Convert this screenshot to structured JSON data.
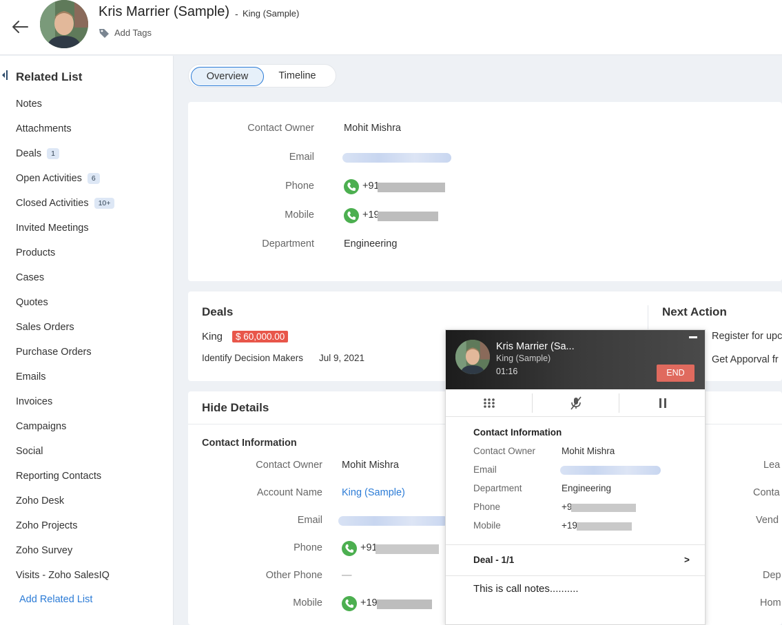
{
  "header": {
    "contact_name": "Kris Marrier (Sample)",
    "separator": "-",
    "account_name": "King (Sample)",
    "add_tags": "Add Tags"
  },
  "sidebar": {
    "title": "Related List",
    "items": [
      {
        "label": "Notes",
        "badge": ""
      },
      {
        "label": "Attachments",
        "badge": ""
      },
      {
        "label": "Deals",
        "badge": "1"
      },
      {
        "label": "Open Activities",
        "badge": "6"
      },
      {
        "label": "Closed Activities",
        "badge": "10+"
      },
      {
        "label": "Invited Meetings",
        "badge": ""
      },
      {
        "label": "Products",
        "badge": ""
      },
      {
        "label": "Cases",
        "badge": ""
      },
      {
        "label": "Quotes",
        "badge": ""
      },
      {
        "label": "Sales Orders",
        "badge": ""
      },
      {
        "label": "Purchase Orders",
        "badge": ""
      },
      {
        "label": "Emails",
        "badge": ""
      },
      {
        "label": "Invoices",
        "badge": ""
      },
      {
        "label": "Campaigns",
        "badge": ""
      },
      {
        "label": "Social",
        "badge": ""
      },
      {
        "label": "Reporting Contacts",
        "badge": ""
      },
      {
        "label": "Zoho Desk",
        "badge": ""
      },
      {
        "label": "Zoho Projects",
        "badge": ""
      },
      {
        "label": "Zoho Survey",
        "badge": ""
      },
      {
        "label": "Visits - Zoho SalesIQ",
        "badge": ""
      }
    ],
    "add_related": "Add Related List"
  },
  "tabs": {
    "overview": "Overview",
    "timeline": "Timeline"
  },
  "summary": {
    "contact_owner_label": "Contact Owner",
    "contact_owner": "Mohit Mishra",
    "email_label": "Email",
    "phone_label": "Phone",
    "phone": "+91",
    "mobile_label": "Mobile",
    "mobile": "+19",
    "department_label": "Department",
    "department": "Engineering"
  },
  "deals": {
    "title": "Deals",
    "deal_name": "King",
    "amount": "$ 60,000.00",
    "stage": "Identify Decision Makers",
    "date": "Jul 9, 2021"
  },
  "next_action": {
    "title": "Next Action",
    "item1": "Register for upc",
    "item2": "Get Apporval fr"
  },
  "details": {
    "hide": "Hide Details",
    "section": "Contact Information",
    "contact_owner_label": "Contact Owner",
    "contact_owner": "Mohit Mishra",
    "account_name_label": "Account Name",
    "account_name": "King (Sample)",
    "email_label": "Email",
    "phone_label": "Phone",
    "phone": "+91",
    "other_phone_label": "Other Phone",
    "other_phone": "—",
    "mobile_label": "Mobile",
    "mobile": "+19",
    "right_labels": [
      "Lea",
      "Conta",
      "Vend",
      "Dep",
      "Hom"
    ]
  },
  "call_popup": {
    "name": "Kris Marrier (Sa...",
    "account": "King (Sample)",
    "duration": "01:16",
    "end_label": "END",
    "section": "Contact Information",
    "contact_owner_label": "Contact Owner",
    "contact_owner": "Mohit Mishra",
    "email_label": "Email",
    "department_label": "Department",
    "department": "Engineering",
    "phone_label": "Phone",
    "phone": "+9",
    "mobile_label": "Mobile",
    "mobile": "+19",
    "deal_label": "Deal - 1/1",
    "deal_chevron": ">",
    "notes": "This is call notes.........."
  },
  "colors": {
    "accent": "#2b7bd6",
    "amount_bg": "#e8564a",
    "end_button": "#e06a5e",
    "phone_green": "#4caf50"
  }
}
